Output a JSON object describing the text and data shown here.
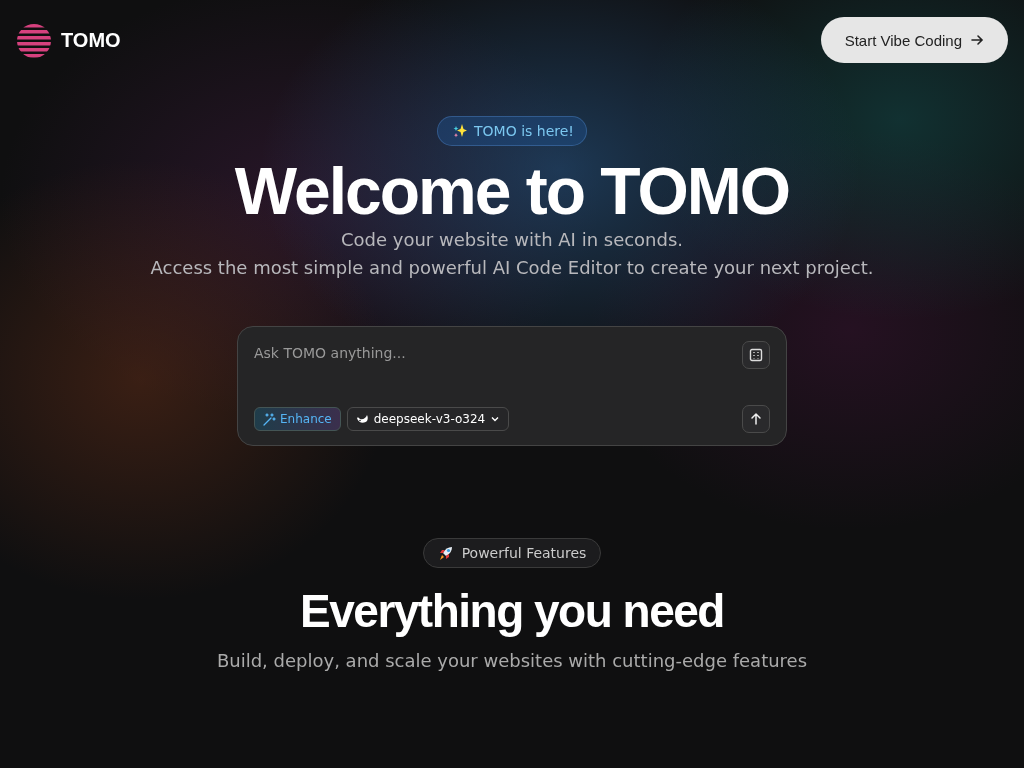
{
  "header": {
    "brand": "TOMO",
    "cta": "Start Vibe Coding"
  },
  "hero": {
    "badge": "TOMO is here!",
    "title": "Welcome to TOMO",
    "subtitle_lines": [
      "Code your website with AI in seconds.",
      "Access the most simple and powerful AI Code Editor to create your next project."
    ]
  },
  "prompt": {
    "placeholder": "Ask TOMO anything...",
    "enhance": "Enhance",
    "model": "deepseek-v3-o324"
  },
  "features": {
    "badge": "Powerful Features",
    "title": "Everything you need",
    "subtitle": "Build, deploy, and scale your websites with cutting-edge features"
  }
}
